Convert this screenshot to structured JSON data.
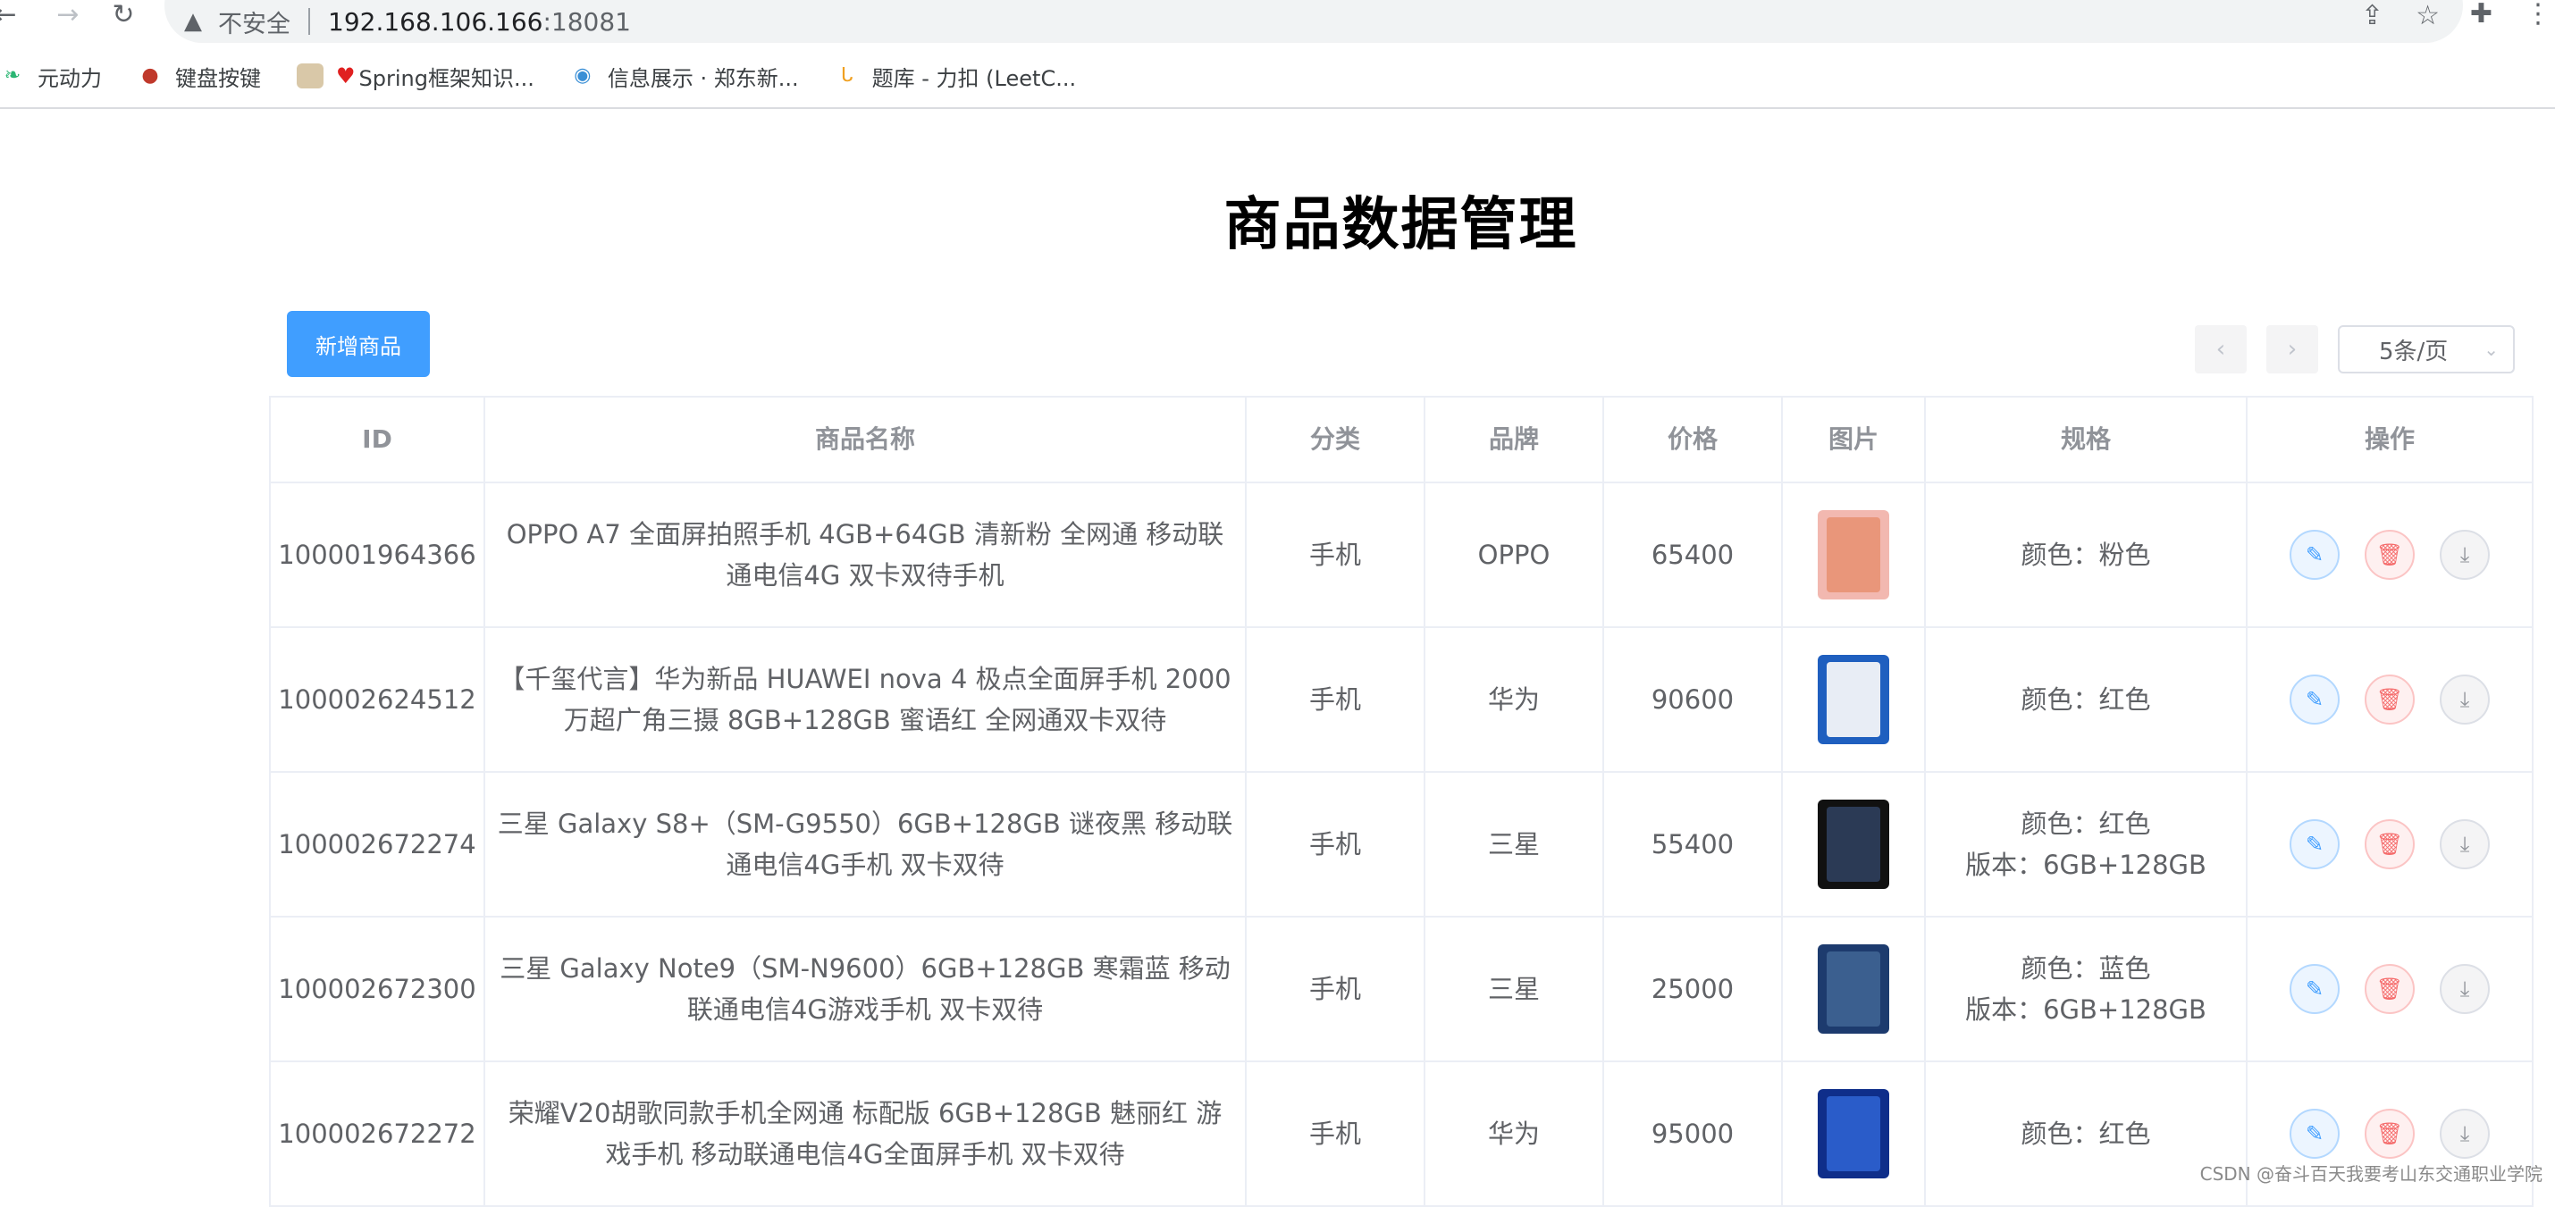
{
  "browser": {
    "insecure_label": "不安全",
    "url_host": "192.168.106.166",
    "url_port": ":18081"
  },
  "bookmarks": [
    {
      "label": "元动力",
      "icon": "leaf-icon",
      "color": "#2bb673"
    },
    {
      "label": "键盘按键",
      "icon": "bird-icon",
      "color": "#c0392b"
    },
    {
      "label": "Spring框架知识...",
      "icon": "heart-icon",
      "color": "#e02020"
    },
    {
      "label": "信息展示 · 郑东新...",
      "icon": "globe-icon",
      "color": "#3a8fd6"
    },
    {
      "label": "题库 - 力扣 (LeetC...",
      "icon": "leetcode-icon",
      "color": "#f0a020"
    }
  ],
  "page": {
    "title": "商品数据管理",
    "add_button": "新增商品",
    "page_size": "5条/页"
  },
  "table": {
    "headers": [
      "ID",
      "商品名称",
      "分类",
      "品牌",
      "价格",
      "图片",
      "规格",
      "操作"
    ],
    "rows": [
      {
        "id": "100001964366",
        "name": "OPPO A7 全面屏拍照手机 4GB+64GB 清新粉 全网通 移动联通电信4G 双卡双待手机",
        "category": "手机",
        "brand": "OPPO",
        "price": "65400",
        "spec": [
          "颜色：粉色"
        ],
        "image_color": "#f2b8b0",
        "screen_color": "#e9967a"
      },
      {
        "id": "100002624512",
        "name": "【千玺代言】华为新品 HUAWEI nova 4 极点全面屏手机 2000万超广角三摄 8GB+128GB 蜜语红 全网通双卡双待",
        "category": "手机",
        "brand": "华为",
        "price": "90600",
        "spec": [
          "颜色：红色"
        ],
        "image_color": "#1f5fbf",
        "screen_color": "#e8edf5"
      },
      {
        "id": "100002672274",
        "name": "三星 Galaxy S8+（SM-G9550）6GB+128GB 谜夜黑 移动联通电信4G手机 双卡双待",
        "category": "手机",
        "brand": "三星",
        "price": "55400",
        "spec": [
          "颜色：红色",
          "版本：6GB+128GB"
        ],
        "image_color": "#111111",
        "screen_color": "#2b3a55"
      },
      {
        "id": "100002672300",
        "name": "三星 Galaxy Note9（SM-N9600）6GB+128GB 寒霜蓝 移动联通电信4G游戏手机 双卡双待",
        "category": "手机",
        "brand": "三星",
        "price": "25000",
        "spec": [
          "颜色：蓝色",
          "版本：6GB+128GB"
        ],
        "image_color": "#1d3b6e",
        "screen_color": "#3b5f8f"
      },
      {
        "id": "100002672272",
        "name": "荣耀V20胡歌同款手机全网通 标配版 6GB+128GB 魅丽红 游戏手机 移动联通电信4G全面屏手机 双卡双待",
        "category": "手机",
        "brand": "华为",
        "price": "95000",
        "spec": [
          "颜色：红色"
        ],
        "image_color": "#0f2e8a",
        "screen_color": "#2a5cc9"
      }
    ]
  },
  "watermark": "CSDN @奋斗百天我要考山东交通职业学院"
}
